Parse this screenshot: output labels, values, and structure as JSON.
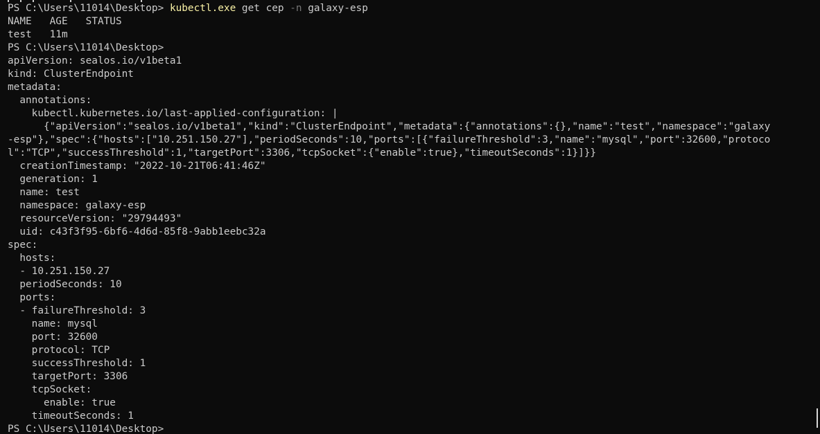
{
  "terminal": {
    "lines": [
      {
        "parts": [
          {
            "t": "PS C:\\Users\\11014\\Desktop> ",
            "c": "text"
          },
          {
            "t": "kubectl.exe",
            "c": "exe"
          },
          {
            "t": " get cep ",
            "c": "text"
          },
          {
            "t": "-n",
            "c": "flag"
          },
          {
            "t": " galaxy-esp",
            "c": "text"
          }
        ]
      },
      {
        "parts": [
          {
            "t": "NAME   AGE   STATUS",
            "c": "text"
          }
        ]
      },
      {
        "parts": [
          {
            "t": "test   11m",
            "c": "text"
          }
        ]
      },
      {
        "parts": [
          {
            "t": "PS C:\\Users\\11014\\Desktop>",
            "c": "text"
          }
        ]
      },
      {
        "parts": [
          {
            "t": "apiVersion: sealos.io/v1beta1",
            "c": "text"
          }
        ]
      },
      {
        "parts": [
          {
            "t": "kind: ClusterEndpoint",
            "c": "text"
          }
        ]
      },
      {
        "parts": [
          {
            "t": "metadata:",
            "c": "text"
          }
        ]
      },
      {
        "parts": [
          {
            "t": "  annotations:",
            "c": "text"
          }
        ]
      },
      {
        "parts": [
          {
            "t": "    kubectl.kubernetes.io/last-applied-configuration: |",
            "c": "text"
          }
        ]
      },
      {
        "parts": [
          {
            "t": "      {\"apiVersion\":\"sealos.io/v1beta1\",\"kind\":\"ClusterEndpoint\",\"metadata\":{\"annotations\":{},\"name\":\"test\",\"namespace\":\"galaxy",
            "c": "text"
          }
        ]
      },
      {
        "parts": [
          {
            "t": "-esp\"},\"spec\":{\"hosts\":[\"10.251.150.27\"],\"periodSeconds\":10,\"ports\":[{\"failureThreshold\":3,\"name\":\"mysql\",\"port\":32600,\"protoco",
            "c": "text"
          }
        ]
      },
      {
        "parts": [
          {
            "t": "l\":\"TCP\",\"successThreshold\":1,\"targetPort\":3306,\"tcpSocket\":{\"enable\":true},\"timeoutSeconds\":1}]}}",
            "c": "text"
          }
        ]
      },
      {
        "parts": [
          {
            "t": "  creationTimestamp: \"2022-10-21T06:41:46Z\"",
            "c": "text"
          }
        ]
      },
      {
        "parts": [
          {
            "t": "  generation: 1",
            "c": "text"
          }
        ]
      },
      {
        "parts": [
          {
            "t": "  name: test",
            "c": "text"
          }
        ]
      },
      {
        "parts": [
          {
            "t": "  namespace: galaxy-esp",
            "c": "text"
          }
        ]
      },
      {
        "parts": [
          {
            "t": "  resourceVersion: \"29794493\"",
            "c": "text"
          }
        ]
      },
      {
        "parts": [
          {
            "t": "  uid: c43f3f95-6bf6-4d6d-85f8-9abb1eebc32a",
            "c": "text"
          }
        ]
      },
      {
        "parts": [
          {
            "t": "spec:",
            "c": "text"
          }
        ]
      },
      {
        "parts": [
          {
            "t": "  hosts:",
            "c": "text"
          }
        ]
      },
      {
        "parts": [
          {
            "t": "  - 10.251.150.27",
            "c": "text"
          }
        ]
      },
      {
        "parts": [
          {
            "t": "  periodSeconds: 10",
            "c": "text"
          }
        ]
      },
      {
        "parts": [
          {
            "t": "  ports:",
            "c": "text"
          }
        ]
      },
      {
        "parts": [
          {
            "t": "  - failureThreshold: 3",
            "c": "text"
          }
        ]
      },
      {
        "parts": [
          {
            "t": "    name: mysql",
            "c": "text"
          }
        ]
      },
      {
        "parts": [
          {
            "t": "    port: 32600",
            "c": "text"
          }
        ]
      },
      {
        "parts": [
          {
            "t": "    protocol: TCP",
            "c": "text"
          }
        ]
      },
      {
        "parts": [
          {
            "t": "    successThreshold: 1",
            "c": "text"
          }
        ]
      },
      {
        "parts": [
          {
            "t": "    targetPort: 3306",
            "c": "text"
          }
        ]
      },
      {
        "parts": [
          {
            "t": "    tcpSocket:",
            "c": "text"
          }
        ]
      },
      {
        "parts": [
          {
            "t": "      enable: true",
            "c": "text"
          }
        ]
      },
      {
        "parts": [
          {
            "t": "    timeoutSeconds: 1",
            "c": "text"
          }
        ]
      },
      {
        "parts": [
          {
            "t": "PS C:\\Users\\11014\\Desktop>",
            "c": "text"
          }
        ]
      }
    ]
  },
  "colors": {
    "background": "#0c0c0c",
    "text": "#cccccc",
    "executable": "#f9f1a5",
    "flag": "#767676"
  }
}
